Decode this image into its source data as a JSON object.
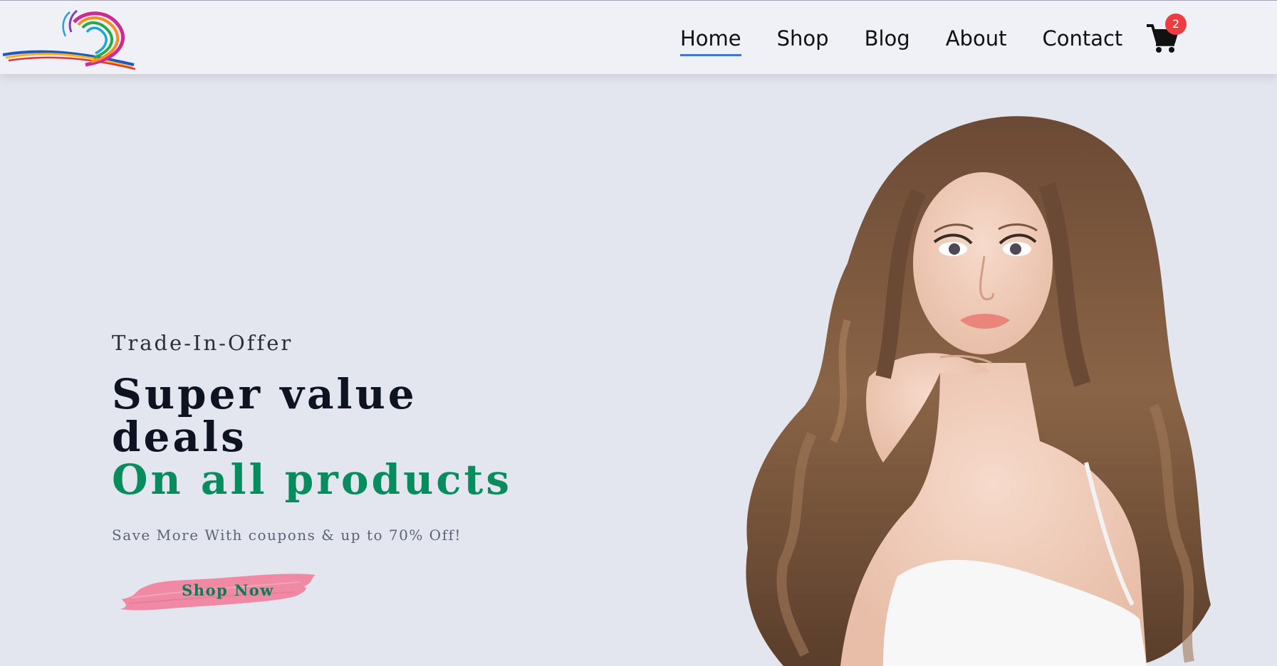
{
  "header": {
    "logo": {
      "icon": "rainbow-swirl-logo-icon"
    },
    "nav": [
      {
        "label": "Home",
        "active": true
      },
      {
        "label": "Shop",
        "active": false
      },
      {
        "label": "Blog",
        "active": false
      },
      {
        "label": "About",
        "active": false
      },
      {
        "label": "Contact",
        "active": false
      }
    ],
    "cart": {
      "icon": "shopping-cart-icon",
      "count": "2"
    }
  },
  "hero": {
    "eyebrow": "Trade-In-Offer",
    "headline_line1": "Super value",
    "headline_line2": "deals",
    "headline_accent": "On all products",
    "subtitle": "Save More With coupons & up to 70% Off!",
    "cta_label": "Shop Now",
    "image": {
      "icon": "model-portrait-image"
    }
  },
  "colors": {
    "background": "#e3e6ee",
    "header_bg": "#eff1f6",
    "accent_green": "#078c5e",
    "nav_underline": "#3b78d8",
    "badge": "#ef3b41",
    "button_brush": "#f08aa4"
  }
}
